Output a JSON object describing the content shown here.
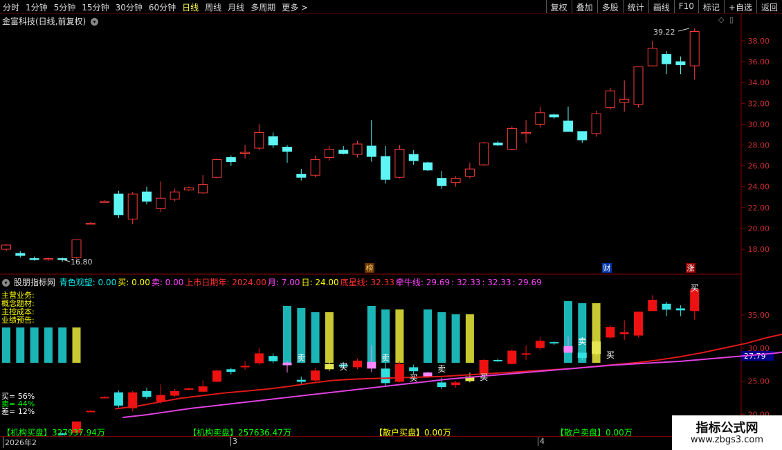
{
  "toolbar": {
    "periods": [
      "分时",
      "1分钟",
      "5分钟",
      "15分钟",
      "30分钟",
      "60分钟",
      "日线",
      "周线",
      "月线",
      "多周期",
      "更多 >"
    ],
    "active_period": "日线",
    "right_buttons": [
      "复权",
      "叠加",
      "多股",
      "统计",
      "画线",
      "F10",
      "标记",
      "+自选",
      "返回"
    ]
  },
  "stock": {
    "title": "金富科技(日线,前复权)"
  },
  "main_chart": {
    "ylabels": [
      "38.00",
      "36.00",
      "34.00",
      "32.00",
      "30.00",
      "28.00",
      "26.00",
      "24.00",
      "22.00",
      "20.00",
      "18.00"
    ],
    "high_label": "39.22",
    "low_label": "16.80",
    "markers": [
      {
        "text": "榜",
        "color": "#ffcc66",
        "bg": "#663300"
      },
      {
        "text": "财",
        "color": "#ffffff",
        "bg": "#0033aa"
      },
      {
        "text": "涨",
        "color": "#ffffff",
        "bg": "#990000"
      }
    ]
  },
  "indicator": {
    "name": "股朋指标网",
    "items": [
      {
        "t": "青色观望: 0.00",
        "c": "#00e5e5"
      },
      {
        "t": "买: 0.00",
        "c": "#ffff00"
      },
      {
        "t": "卖: 0.00",
        "c": "#ff44ff"
      },
      {
        "t": "上市日期年: 2024.00",
        "c": "#ff3030"
      },
      {
        "t": "月: 7.00",
        "c": "#ff44ff"
      },
      {
        "t": "日: 24.00",
        "c": "#ffff00"
      },
      {
        "t": "底星线: 32.33",
        "c": "#ff3030"
      },
      {
        "t": "牵牛线: 29.69",
        "c": "#ff44ff"
      },
      {
        "t": ": 32.33",
        "c": "#ff44ff"
      },
      {
        "t": ": 32.33",
        "c": "#ff44ff"
      },
      {
        "t": ": 29.69",
        "c": "#ff44ff"
      }
    ],
    "side_labels": [
      "主营业务:",
      "概念题材:",
      "主控成本:",
      "业绩预告:"
    ],
    "pct": [
      {
        "t": "买= 56%",
        "c": "#ffffff"
      },
      {
        "t": "卖= 44%",
        "c": "#00ff00"
      },
      {
        "t": "差= 12%",
        "c": "#ffffff"
      }
    ],
    "ylabels": [
      "35.00",
      "30.00",
      "25.00",
      "20.00"
    ],
    "current_value": "27.79",
    "signals": {
      "buy": "买",
      "sell": "卖"
    }
  },
  "bottom_stats": [
    {
      "t": "【机构买盘】327937.94万",
      "c": "#00ff00"
    },
    {
      "t": "【机构卖盘】257636.47万",
      "c": "#00ff00"
    },
    {
      "t": "【散户买盘】0.00万",
      "c": "#ffff00"
    },
    {
      "t": "【散户卖盘】0.00万",
      "c": "#00ff00"
    }
  ],
  "date_axis": [
    "2026年2",
    "3",
    "4"
  ],
  "watermark": {
    "line1": "指标公式网",
    "line2": "www.zbgs3.com"
  },
  "chart_data": {
    "type": "candlestick",
    "candles": [
      [
        18.0,
        18.4,
        17.8,
        18.5
      ],
      [
        17.6,
        17.4,
        17.2,
        17.8
      ],
      [
        17.1,
        17.0,
        16.9,
        17.3
      ],
      [
        17.0,
        17.1,
        16.9,
        17.2
      ],
      [
        17.1,
        17.0,
        16.8,
        17.2
      ],
      [
        17.2,
        18.9,
        17.1,
        18.9
      ],
      [
        20.5,
        20.5,
        20.4,
        20.6
      ],
      [
        22.6,
        22.6,
        22.5,
        22.7
      ],
      [
        23.3,
        21.3,
        21.0,
        23.6
      ],
      [
        20.9,
        23.3,
        20.4,
        23.5
      ],
      [
        23.5,
        22.6,
        22.3,
        24.0
      ],
      [
        21.9,
        22.9,
        21.6,
        24.5
      ],
      [
        22.8,
        23.5,
        22.6,
        23.8
      ],
      [
        23.7,
        23.9,
        23.6,
        24.0
      ],
      [
        23.4,
        24.2,
        23.3,
        25.1
      ],
      [
        24.9,
        26.6,
        24.8,
        26.7
      ],
      [
        26.8,
        26.4,
        26.0,
        27.0
      ],
      [
        27.2,
        27.3,
        26.7,
        28.0
      ],
      [
        27.7,
        29.2,
        27.5,
        30.0
      ],
      [
        28.8,
        28.0,
        27.7,
        29.2
      ],
      [
        27.8,
        27.4,
        26.3,
        28.0
      ],
      [
        25.2,
        24.9,
        24.6,
        25.7
      ],
      [
        25.1,
        26.6,
        24.9,
        27.0
      ],
      [
        26.8,
        27.6,
        26.5,
        27.9
      ],
      [
        27.5,
        27.2,
        27.1,
        27.9
      ],
      [
        27.1,
        28.1,
        26.8,
        28.4
      ],
      [
        27.9,
        26.9,
        26.4,
        30.4
      ],
      [
        26.9,
        24.7,
        24.3,
        27.9
      ],
      [
        24.9,
        27.6,
        24.8,
        28.0
      ],
      [
        27.1,
        26.5,
        26.1,
        27.5
      ],
      [
        26.3,
        25.6,
        25.5,
        26.4
      ],
      [
        24.8,
        24.1,
        23.8,
        25.5
      ],
      [
        24.4,
        24.8,
        24.0,
        25.0
      ],
      [
        25.0,
        25.7,
        24.8,
        26.3
      ],
      [
        26.1,
        28.2,
        26.0,
        28.3
      ],
      [
        28.2,
        28.0,
        27.9,
        28.4
      ],
      [
        27.6,
        29.6,
        27.5,
        29.8
      ],
      [
        29.2,
        29.2,
        28.2,
        30.4
      ],
      [
        30.0,
        31.1,
        29.7,
        31.7
      ],
      [
        30.9,
        30.7,
        30.5,
        31.0
      ],
      [
        30.3,
        29.3,
        29.3,
        31.7
      ],
      [
        29.3,
        28.5,
        28.2,
        29.2
      ],
      [
        29.1,
        31.0,
        28.8,
        31.3
      ],
      [
        31.6,
        33.2,
        31.4,
        33.5
      ],
      [
        32.1,
        32.4,
        31.2,
        34.2
      ],
      [
        31.9,
        35.5,
        31.6,
        35.5
      ],
      [
        35.6,
        37.3,
        35.6,
        38.0
      ],
      [
        36.7,
        35.8,
        34.8,
        37.0
      ],
      [
        36.0,
        35.7,
        34.8,
        36.5
      ],
      [
        35.6,
        38.9,
        34.3,
        39.2
      ]
    ],
    "ma_red": [
      20.8,
      21.2,
      21.8,
      22.4,
      22.8,
      23.2,
      23.5,
      23.8,
      24.2,
      24.7,
      25.1,
      25.3,
      25.4,
      25.5,
      25.6,
      25.7,
      25.9,
      26.1,
      26.3,
      26.5,
      26.7,
      26.9,
      27.2,
      27.5,
      27.8,
      28.2,
      28.7,
      29.3,
      30.0,
      30.7,
      31.6,
      32.33
    ],
    "ma_purple": [
      19.5,
      19.9,
      20.4,
      20.9,
      21.3,
      21.7,
      22.1,
      22.5,
      22.9,
      23.3,
      23.7,
      24.1,
      24.5,
      24.9,
      25.3,
      25.6,
      25.9,
      26.2,
      26.5,
      26.8,
      27.1,
      27.4,
      27.6,
      27.8,
      28.0,
      28.3,
      28.6,
      28.9,
      29.2,
      29.69
    ]
  }
}
